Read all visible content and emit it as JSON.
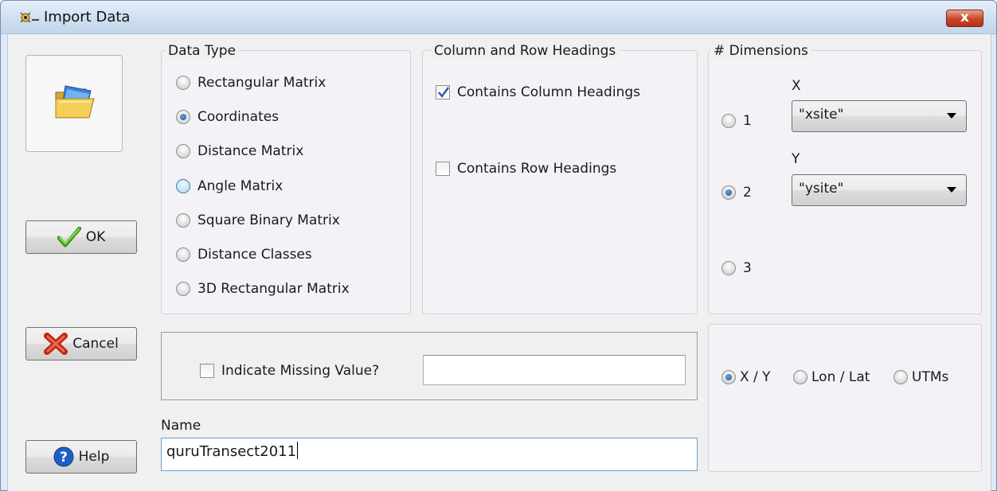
{
  "window": {
    "title": "Import Data",
    "close_glyph": "x"
  },
  "buttons": {
    "ok": "OK",
    "cancel": "Cancel",
    "help": "Help"
  },
  "data_type": {
    "legend": "Data Type",
    "options": [
      "Rectangular Matrix",
      "Coordinates",
      "Distance Matrix",
      "Angle Matrix",
      "Square Binary Matrix",
      "Distance Classes",
      "3D Rectangular Matrix"
    ],
    "selected": "Coordinates"
  },
  "headings": {
    "legend": "Column and Row Headings",
    "contains_column": {
      "label": "Contains Column Headings",
      "checked": true
    },
    "contains_row": {
      "label": "Contains Row Headings",
      "checked": false
    }
  },
  "dimensions": {
    "legend": "# Dimensions",
    "options": [
      "1",
      "2",
      "3"
    ],
    "selected": "2",
    "x_label": "X",
    "x_value": "\"xsite\"",
    "y_label": "Y",
    "y_value": "\"ysite\""
  },
  "missing": {
    "label": "Indicate Missing Value?",
    "checked": false,
    "value": ""
  },
  "name": {
    "label": "Name",
    "value": "quruTransect2011"
  },
  "coord_system": {
    "options": [
      "X / Y",
      "Lon / Lat",
      "UTMs"
    ],
    "selected": "X / Y"
  },
  "icons": [
    "app-icon",
    "folder-icon",
    "checkmark-icon",
    "red-x-icon",
    "help-icon",
    "close-icon"
  ],
  "colors": {
    "titlebar": "#cfdff0",
    "close_button": "#c9452a",
    "radio_selected": "#1c4f93"
  }
}
